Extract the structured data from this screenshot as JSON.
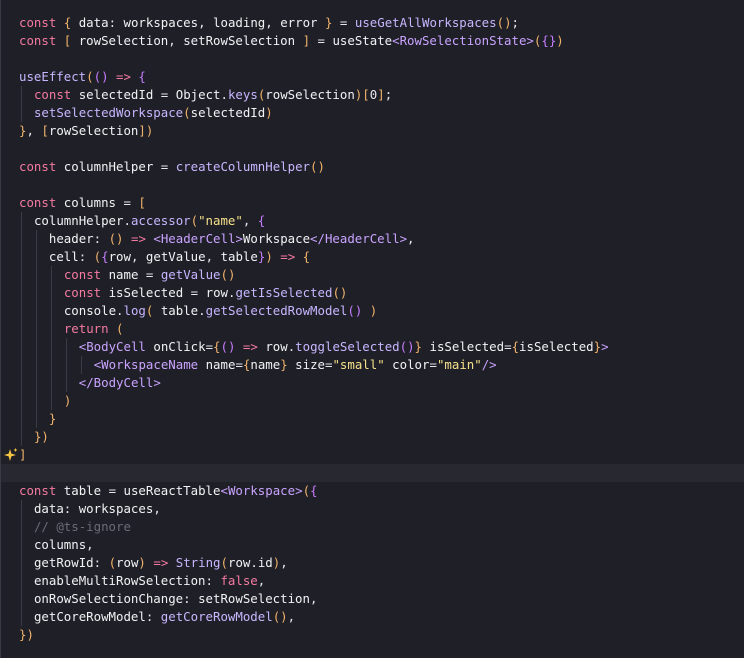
{
  "editor": {
    "theme_colors": {
      "background": "#1f1f27",
      "current_line": "#282830",
      "keyword": "#f47aa0",
      "string": "#f4e08a",
      "tag": "#c9a3ff",
      "comment": "#6b6b78",
      "text": "#e6e6ee"
    },
    "gutter_icon": "ai-sparkle-icon",
    "current_line_index": 25,
    "lines": [
      "const { data: workspaces, loading, error } = useGetAllWorkspaces();",
      "const [ rowSelection, setRowSelection ] = useState<RowSelectionState>({})",
      "",
      "useEffect(() => {",
      "  const selectedId = Object.keys(rowSelection)[0];",
      "  setSelectedWorkspace(selectedId)",
      "}, [rowSelection])",
      "",
      "const columnHelper = createColumnHelper()",
      "",
      "const columns = [",
      "  columnHelper.accessor(\"name\", {",
      "    header: () => <HeaderCell>Workspace</HeaderCell>,",
      "    cell: ({row, getValue, table}) => {",
      "      const name = getValue()",
      "      const isSelected = row.getIsSelected()",
      "      console.log( table.getSelectedRowModel() )",
      "      return (",
      "        <BodyCell onClick={() => row.toggleSelected()} isSelected={isSelected}>",
      "          <WorkspaceName name={name} size=\"small\" color=\"main\"/>",
      "        </BodyCell>",
      "      )",
      "    }",
      "  })",
      "]",
      "",
      "const table = useReactTable<Workspace>({",
      "  data: workspaces,",
      "  // @ts-ignore",
      "  columns,",
      "  getRowId: (row) => String(row.id),",
      "  enableMultiRowSelection: false,",
      "  onRowSelectionChange: setRowSelection,",
      "  getCoreRowModel: getCoreRowModel(),",
      "})"
    ]
  }
}
